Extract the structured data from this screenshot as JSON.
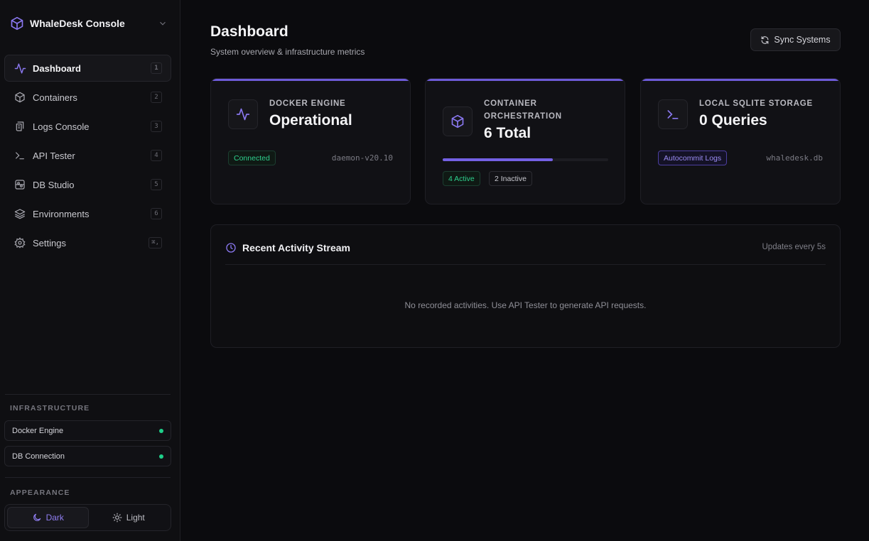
{
  "app": {
    "title": "WhaleDesk Console"
  },
  "sidebar": {
    "items": [
      {
        "label": "Dashboard",
        "shortcut": "1",
        "icon": "activity-icon",
        "active": true
      },
      {
        "label": "Containers",
        "shortcut": "2",
        "icon": "box-icon"
      },
      {
        "label": "Logs Console",
        "shortcut": "3",
        "icon": "scroll-icon"
      },
      {
        "label": "API Tester",
        "shortcut": "4",
        "icon": "terminal-icon"
      },
      {
        "label": "DB Studio",
        "shortcut": "5",
        "icon": "database-icon"
      },
      {
        "label": "Environments",
        "shortcut": "6",
        "icon": "layers-icon"
      },
      {
        "label": "Settings",
        "shortcut": "⌘,",
        "icon": "gear-icon"
      }
    ],
    "infrastructure": {
      "title": "INFRASTRUCTURE",
      "items": [
        {
          "label": "Docker Engine",
          "status_color": "#1fd08a"
        },
        {
          "label": "DB Connection",
          "status_color": "#1fd08a"
        }
      ]
    },
    "appearance": {
      "title": "APPEARANCE",
      "dark_label": "Dark",
      "light_label": "Light",
      "selected": "Dark"
    }
  },
  "header": {
    "title": "Dashboard",
    "subtitle": "System overview & infrastructure metrics",
    "sync_label": "Sync Systems"
  },
  "cards": {
    "docker": {
      "label": "DOCKER ENGINE",
      "value": "Operational",
      "badge": "Connected",
      "meta": "daemon-v20.10"
    },
    "orchestration": {
      "label_line1": "CONTAINER",
      "label_line2": "ORCHESTRATION",
      "value": "6 Total",
      "active_fraction": 0.667,
      "active_badge": "4 Active",
      "inactive_badge": "2 Inactive"
    },
    "storage": {
      "label": "LOCAL SQLITE STORAGE",
      "value": "0 Queries",
      "badge": "Autocommit Logs",
      "meta": "whaledesk.db"
    }
  },
  "activity": {
    "title": "Recent Activity Stream",
    "update_note": "Updates every 5s",
    "empty_text": "No recorded activities. Use API Tester to generate API requests."
  },
  "colors": {
    "accent": "#6d5bd8",
    "success": "#1fd08a",
    "background": "#0b0b0e"
  }
}
